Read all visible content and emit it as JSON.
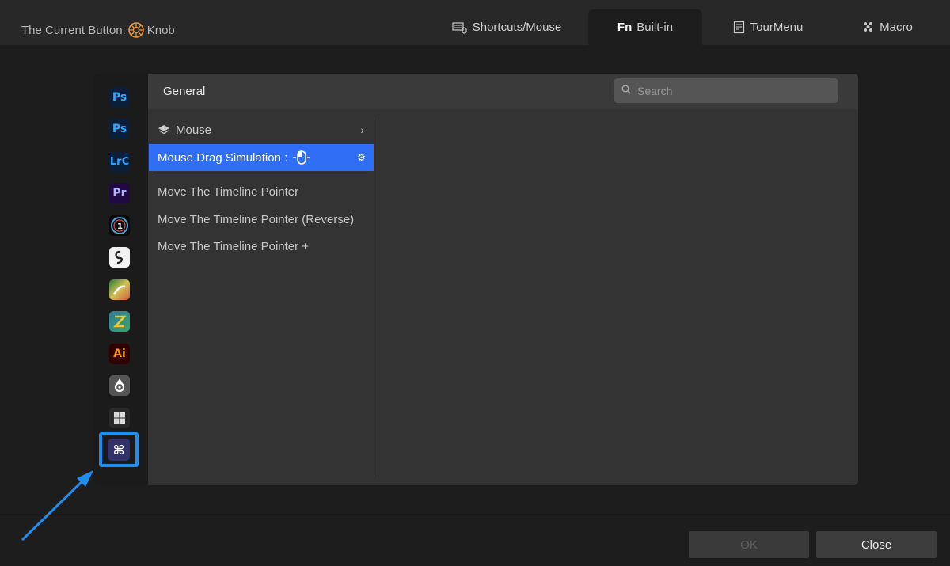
{
  "header": {
    "current_label": "The Current Button:",
    "current_value": "Knob",
    "knob_color": "#e8953a"
  },
  "tabs": [
    {
      "label": "Shortcuts/Mouse",
      "icon": "keyboard-mouse-icon",
      "active": false
    },
    {
      "label": "Built-in",
      "icon": "fn-icon",
      "active": true
    },
    {
      "label": "TourMenu",
      "icon": "tour-menu-icon",
      "active": false
    },
    {
      "label": "Macro",
      "icon": "macro-icon",
      "active": false
    }
  ],
  "sidebar": {
    "apps": [
      {
        "name": "Photoshop",
        "glyph": "Ps",
        "bg": "#0c1f3a",
        "fg": "#31a8ff"
      },
      {
        "name": "Photoshop",
        "glyph": "Ps",
        "bg": "#0c1f3a",
        "fg": "#31a8ff"
      },
      {
        "name": "Lightroom Classic",
        "glyph": "LrC",
        "bg": "#0c1f3a",
        "fg": "#31a8ff"
      },
      {
        "name": "Premiere Pro",
        "glyph": "Pr",
        "bg": "#1f0a44",
        "fg": "#b3b3ff"
      },
      {
        "name": "Capture One",
        "glyph": "1",
        "bg": "#0a0a0a",
        "fg": "#ffffff"
      },
      {
        "name": "Clip Studio Paint",
        "glyph": "S",
        "bg": "#f2f2f2",
        "fg": "#222222"
      },
      {
        "name": "Krita",
        "glyph": "",
        "bg": "#5aa86b",
        "fg": "#ffffff"
      },
      {
        "name": "Rebelle",
        "glyph": "Z",
        "bg": "#2a6b8a",
        "fg": "#f2c531"
      },
      {
        "name": "Illustrator",
        "glyph": "Ai",
        "bg": "#330000",
        "fg": "#ff9a00"
      },
      {
        "name": "Blender",
        "glyph": "8",
        "bg": "#555555",
        "fg": "#ffffff"
      },
      {
        "name": "Windows",
        "glyph": "⊞",
        "bg": "#2a2a2a",
        "fg": "#dddddd"
      },
      {
        "name": "Mac",
        "glyph": "⌘",
        "bg": "#33336b",
        "fg": "#ffffff",
        "selected": true
      }
    ]
  },
  "content": {
    "section_title": "General",
    "search_placeholder": "Search",
    "group": "Mouse",
    "selected_item": "Mouse Drag Simulation :",
    "items": [
      "Move The Timeline Pointer",
      "Move The Timeline Pointer (Reverse)",
      "Move The Timeline Pointer +"
    ]
  },
  "footer": {
    "ok_label": "OK",
    "close_label": "Close"
  },
  "colors": {
    "accent": "#2f6ef5",
    "highlight_border": "#1f8ef1"
  }
}
